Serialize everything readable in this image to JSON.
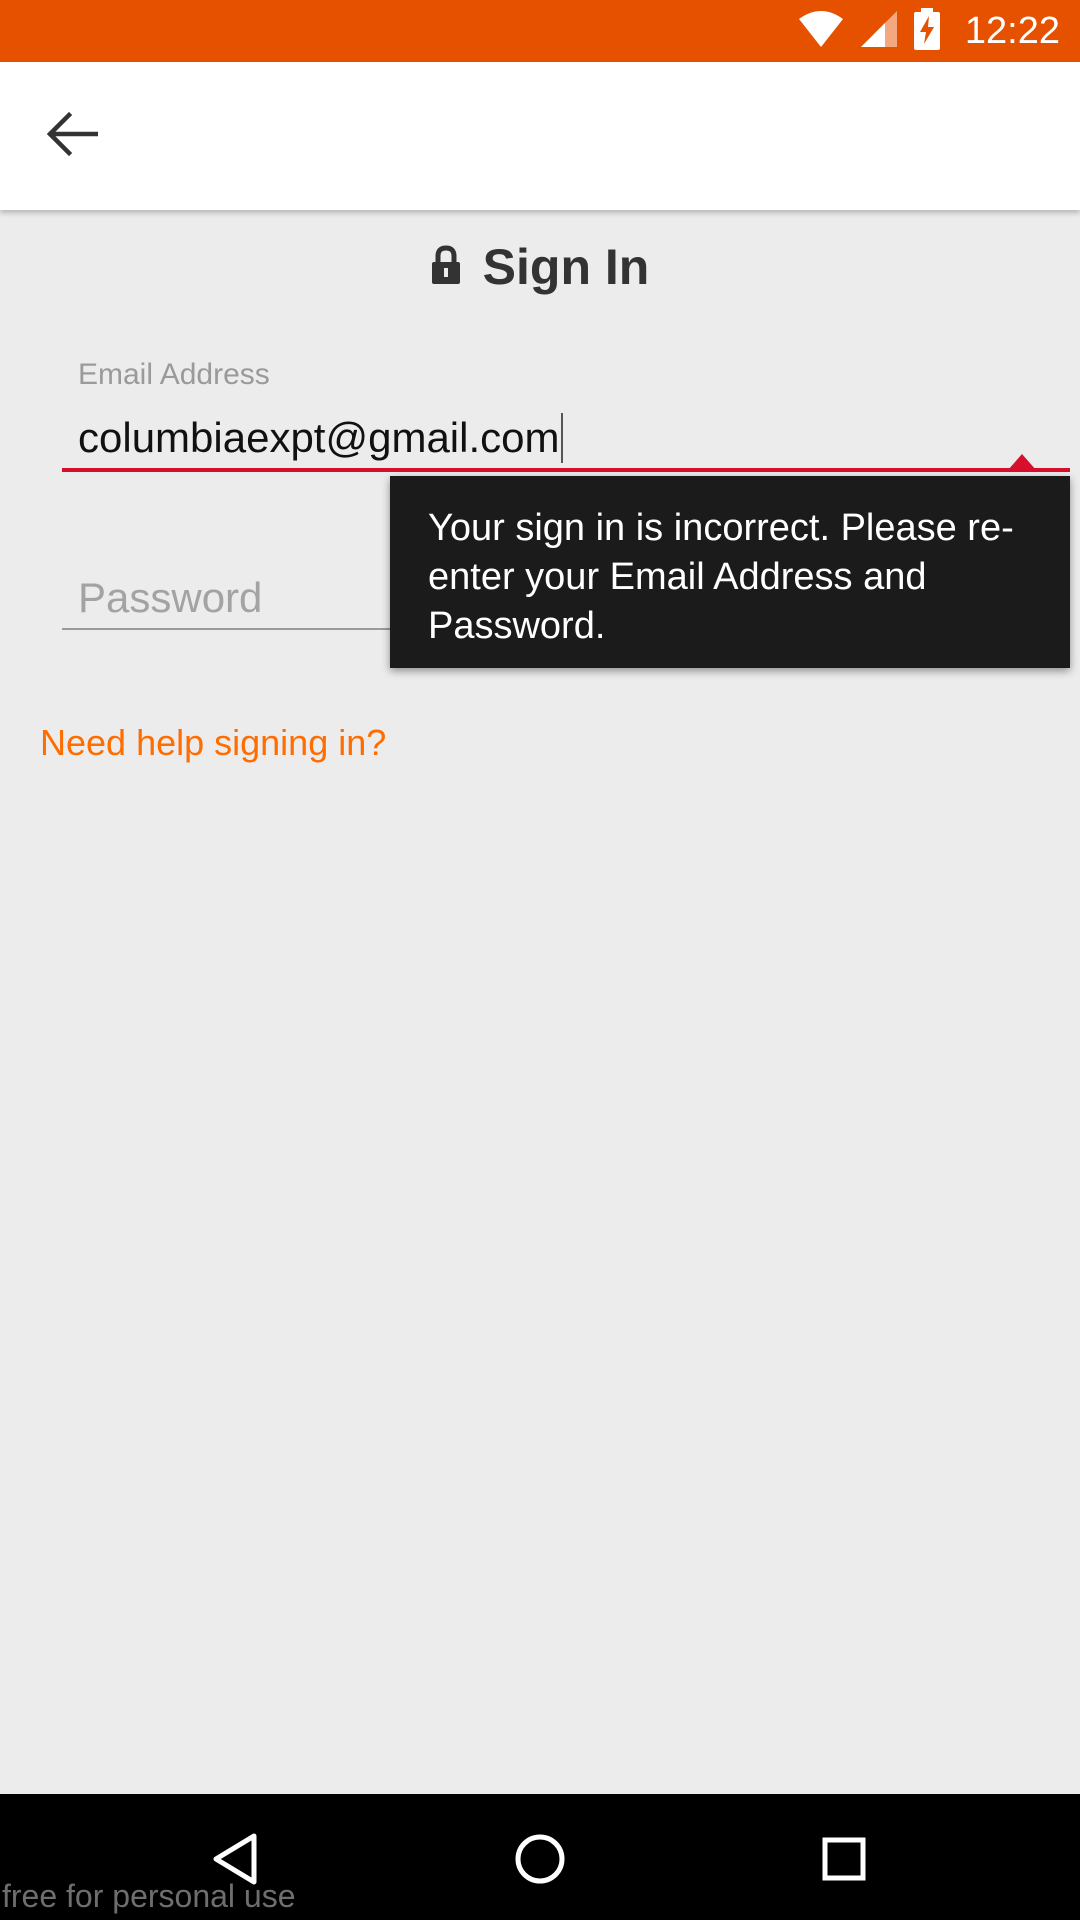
{
  "status_bar": {
    "time": "12:22",
    "background_color": "#e65100",
    "icons": [
      "wifi-icon",
      "cell-signal-icon",
      "battery-charging-icon"
    ]
  },
  "app_bar": {
    "back_icon": "arrow-left-icon"
  },
  "signin": {
    "title": "Sign In",
    "title_icon": "lock-icon",
    "email_label": "Email Address",
    "email_value": "columbiaexpt@gmail.com",
    "password_placeholder": "Password",
    "password_toggle_icon": "eye-icon",
    "error_message": "Your sign in is incorrect. Please re-enter your Email Address and Password.",
    "help_link": "Need help signing in?",
    "error_color": "#d50f2c",
    "accent_color": "#ff6d00"
  },
  "nav_bar": {
    "back_icon": "nav-back-icon",
    "home_icon": "nav-home-icon",
    "recents_icon": "nav-recents-icon"
  },
  "watermark": "free for personal use"
}
